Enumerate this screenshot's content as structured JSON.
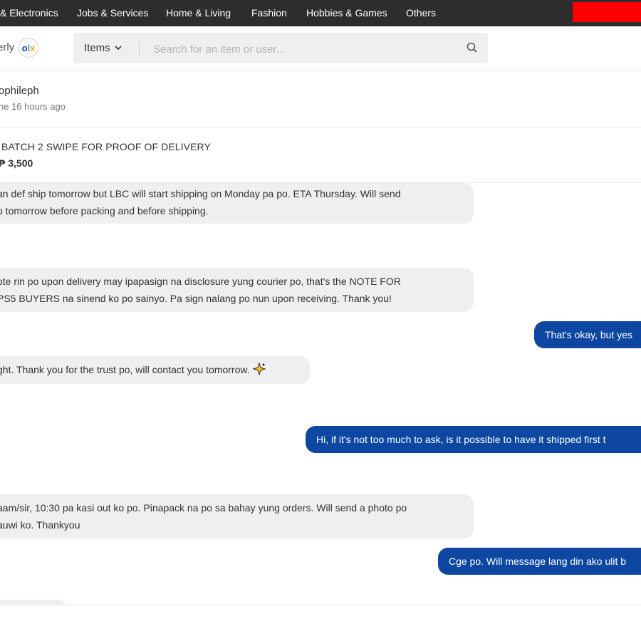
{
  "categories": [
    "& Electronics",
    "Jobs & Services",
    "Home & Living",
    "Fashion",
    "Hobbies & Games",
    "Others"
  ],
  "brand": {
    "site_name_partial": "erly",
    "logo_text_o": "o",
    "logo_text_l": "l",
    "logo_text_x": "x"
  },
  "search": {
    "category_label": "Items",
    "placeholder": "Search for an item or user..."
  },
  "conversation": {
    "username": "ophileph",
    "last_seen": "ne 16 hours ago"
  },
  "listing": {
    "title": "BATCH 2 SWIPE FOR PROOF OF DELIVERY",
    "price": "₱ 3,500"
  },
  "messages": [
    {
      "direction": "in",
      "lines": [
        "an def ship tomorrow but LBC will start shipping on Monday pa po. ETA Thursday. Will send",
        "o tomorrow before packing and before shipping."
      ]
    },
    {
      "direction": "in",
      "lines": [
        "ote rin po upon delivery may ipapasign na disclosure yung courier po, that's the NOTE FOR",
        "PS5 BUYERS na sinend ko po sainyo. Pa sign nalang po nun upon receiving. Thank you!"
      ]
    },
    {
      "direction": "out",
      "lines": [
        "That's okay, but yes"
      ]
    },
    {
      "direction": "in",
      "lines": [
        "ght. Thank you for the trust po, will contact you tomorrow."
      ],
      "emoji": "sparkle-emoji"
    },
    {
      "direction": "out",
      "lines": [
        "Hi, if it's not too much to ask, is it possible to have it shipped first t"
      ]
    },
    {
      "direction": "in",
      "lines": [
        "aam/sir, 10:30 pa kasi out ko po. Pinapack na po sa bahay yung orders. Will send a photo po",
        "auwi ko. Thankyou"
      ]
    },
    {
      "direction": "out",
      "lines": [
        "Cge po. Will message lang din ako ulit b"
      ]
    }
  ],
  "colors": {
    "topbar": "#2d2d2d",
    "promo_red": "#ff0000",
    "outgoing_bubble": "#0d47a1",
    "incoming_bubble": "#efefef"
  }
}
